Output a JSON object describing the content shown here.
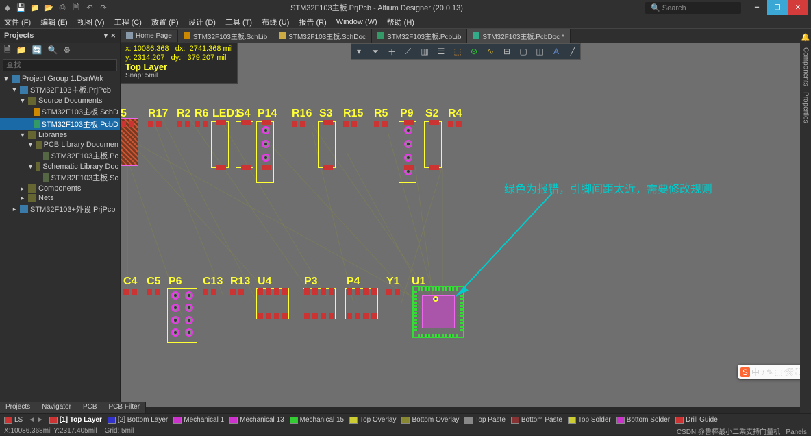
{
  "title": "STM32F103主板.PrjPcb - Altium Designer (20.0.13)",
  "search_placeholder": "Search",
  "menu": [
    "文件 (F)",
    "编辑 (E)",
    "视图 (V)",
    "工程 (C)",
    "放置 (P)",
    "设计 (D)",
    "工具 (T)",
    "布线 (U)",
    "报告 (R)",
    "Window (W)",
    "帮助 (H)"
  ],
  "right_rail": [
    "Components",
    "Properties"
  ],
  "projects_panel": {
    "title": "Projects",
    "search": "查找",
    "tree": [
      {
        "ind": 0,
        "exp": "▼",
        "ic": "prj",
        "label": "Project Group 1.DsnWrk",
        "sel": false
      },
      {
        "ind": 1,
        "exp": "▼",
        "ic": "prj",
        "label": "STM32F103主板.PrjPcb",
        "sel": false
      },
      {
        "ind": 2,
        "exp": "▼",
        "ic": "fld",
        "label": "Source Documents",
        "sel": false
      },
      {
        "ind": 3,
        "exp": "",
        "ic": "sch",
        "label": "STM32F103主板.SchD",
        "sel": false
      },
      {
        "ind": 3,
        "exp": "",
        "ic": "pcb",
        "label": "STM32F103主板.PcbD",
        "sel": true
      },
      {
        "ind": 2,
        "exp": "▼",
        "ic": "fld",
        "label": "Libraries",
        "sel": false
      },
      {
        "ind": 3,
        "exp": "▼",
        "ic": "fld",
        "label": "PCB Library Documen",
        "sel": false
      },
      {
        "ind": 4,
        "exp": "",
        "ic": "lib",
        "label": "STM32F103主板.Pc",
        "sel": false
      },
      {
        "ind": 3,
        "exp": "▼",
        "ic": "fld",
        "label": "Schematic Library Doc",
        "sel": false
      },
      {
        "ind": 4,
        "exp": "",
        "ic": "lib",
        "label": "STM32F103主板.Sc",
        "sel": false
      },
      {
        "ind": 2,
        "exp": "▸",
        "ic": "fld",
        "label": "Components",
        "sel": false
      },
      {
        "ind": 2,
        "exp": "▸",
        "ic": "fld",
        "label": "Nets",
        "sel": false
      },
      {
        "ind": 1,
        "exp": "▸",
        "ic": "prj",
        "label": "STM32F103+外设.PrjPcb",
        "sel": false
      }
    ]
  },
  "tabs": [
    {
      "ic": "home",
      "label": "Home Page"
    },
    {
      "ic": "schlib",
      "label": "STM32F103主板.SchLib"
    },
    {
      "ic": "schdoc",
      "label": "STM32F103主板.SchDoc"
    },
    {
      "ic": "pcblib",
      "label": "STM32F103主板.PcbLib"
    },
    {
      "ic": "pcbdoc",
      "label": "STM32F103主板.PcbDoc *",
      "active": true
    }
  ],
  "cursor_info": {
    "x": "10086.368",
    "dx": "2741.368 mil",
    "y": "2314.207",
    "dy": "379.207 mil",
    "layer": "Top Layer",
    "snap": "Snap: 5mil"
  },
  "annotation": "绿色为报错，引脚间距太近，需要修改规则",
  "components_top": [
    "5",
    "R17",
    "R2",
    "R6",
    "LED1",
    "S4",
    "P14",
    "R16",
    "S3",
    "R15",
    "R5",
    "P9",
    "S2",
    "R4"
  ],
  "components_bot": [
    "C4",
    "C5",
    "P6",
    "C13",
    "R13",
    "U4",
    "P3",
    "P4",
    "Y1",
    "U1"
  ],
  "layer_tabs": {
    "ls": "LS",
    "items": [
      {
        "c": "#cc3333",
        "l": "[1] Top Layer",
        "active": true
      },
      {
        "c": "#3333cc",
        "l": "[2] Bottom Layer"
      },
      {
        "c": "#cc33cc",
        "l": "Mechanical 1"
      },
      {
        "c": "#cc33cc",
        "l": "Mechanical 13"
      },
      {
        "c": "#33cc33",
        "l": "Mechanical 15"
      },
      {
        "c": "#cccc33",
        "l": "Top Overlay"
      },
      {
        "c": "#888833",
        "l": "Bottom Overlay"
      },
      {
        "c": "#888888",
        "l": "Top Paste"
      },
      {
        "c": "#883333",
        "l": "Bottom Paste"
      },
      {
        "c": "#cccc33",
        "l": "Top Solder"
      },
      {
        "c": "#cc33cc",
        "l": "Bottom Solder"
      },
      {
        "c": "#cc3333",
        "l": "Drill Guide"
      }
    ]
  },
  "bottom_tabs": [
    "Projects",
    "Navigator",
    "PCB",
    "PCB Filter"
  ],
  "status": {
    "xy": "X:10086.368mil Y:2317.405mil",
    "grid": "Grid: 5mil",
    "credit": "CSDN @鲁棒最小二乘支持向量机",
    "panels": "Panels"
  }
}
